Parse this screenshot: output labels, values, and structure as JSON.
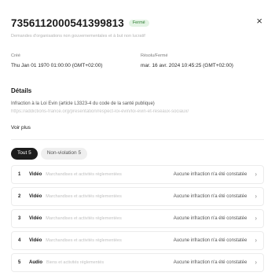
{
  "header": {
    "title": "7356112000541399813",
    "badge": "Fermé",
    "subtitle": "Demandes d'organisations non gouvernementales et à but non lucratif",
    "close_icon": "×"
  },
  "meta": {
    "created_label": "Créé",
    "created_value": "Thu Jan 01 1970 01:00:00 (GMT+02:00)",
    "resolved_label": "Résolu/Fermé",
    "resolved_value": "mar. 16 avr. 2024 10:45:25 (GMT+02:00)"
  },
  "details": {
    "title": "Détails",
    "text": "Infraction à la Loi Evin (article L3323-4 du code de la santé publique)",
    "url": "https://addictions-france.org/presentation/respect-loi-evin/loi-evin-et-reseaux-sociaux/",
    "voir_plus": "Voir plus"
  },
  "filters": [
    {
      "label": "Tout 5"
    },
    {
      "label": "Non-violation 5"
    }
  ],
  "rows": [
    {
      "num": "1",
      "type": "Vidéo",
      "category": "Marchandises et activités réglementées",
      "status": "Aucune infraction n'a été constatée"
    },
    {
      "num": "2",
      "type": "Vidéo",
      "category": "Marchandises et activités réglementées",
      "status": "Aucune infraction n'a été constatée"
    },
    {
      "num": "3",
      "type": "Vidéo",
      "category": "Marchandises et activités réglementées",
      "status": "Aucune infraction n'a été constatée"
    },
    {
      "num": "4",
      "type": "Vidéo",
      "category": "Marchandises et activités réglementées",
      "status": "Aucune infraction n'a été constatée"
    },
    {
      "num": "5",
      "type": "Audio",
      "category": "Biens et activités réglementés",
      "status": "Aucune infraction n'a été constatée"
    }
  ],
  "icons": {
    "close": "close-icon",
    "chevron": "chevron-right-icon",
    "chevron_glyph": "›"
  }
}
